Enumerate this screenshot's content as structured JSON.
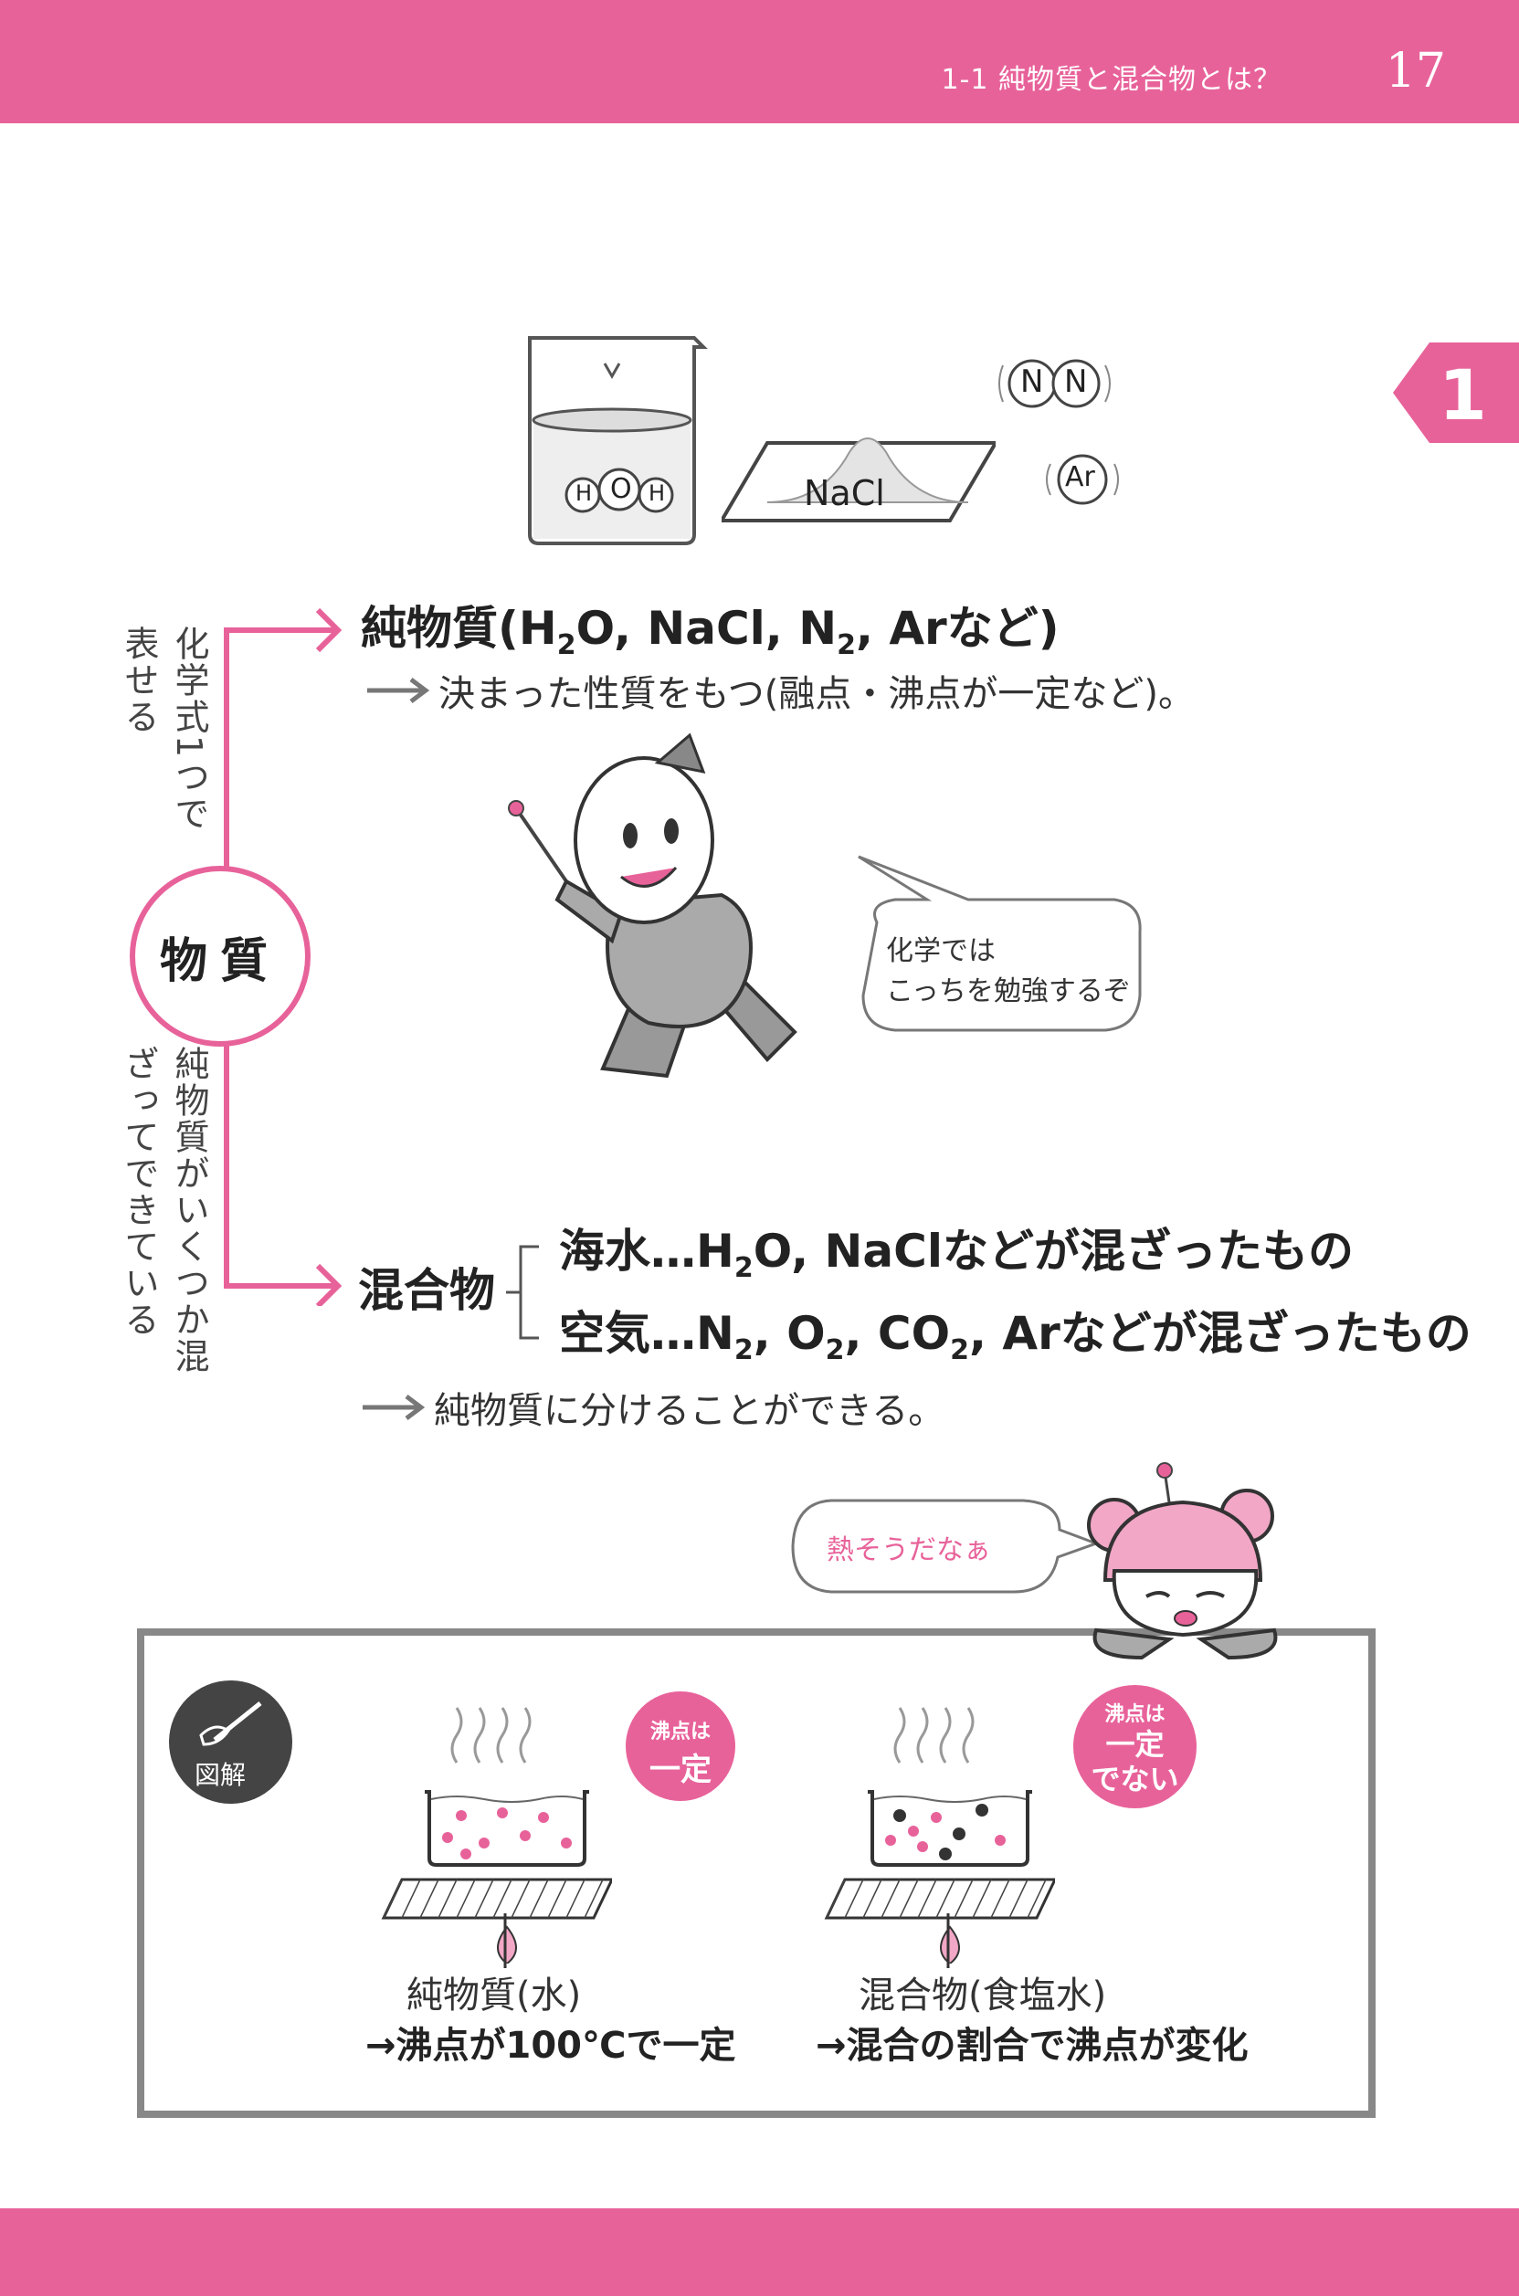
{
  "header": {
    "section_title": "1-1  純物質と混合物とは？",
    "page_number": "17",
    "chapter_tab": "1"
  },
  "illustrations": {
    "water_atoms": [
      "H",
      "O",
      "H"
    ],
    "salt_label": "NaCl",
    "gas_atoms": [
      "N",
      "N",
      "Ar"
    ]
  },
  "substance_circle": "物質",
  "left_labels": {
    "top": "化学式1つで表せる",
    "bottom": "純物質がいくつか混ざってできている"
  },
  "pure": {
    "heading_prefix": "純物質(H",
    "heading_sub": "2",
    "heading_rest": "O, NaCl, N",
    "heading_sub2": "2",
    "heading_end": ", Arなど)",
    "note": "決まった性質をもつ(融点・沸点が一定など)。"
  },
  "professor_bubble": {
    "line1": "化学では",
    "line2": "こっちを勉強するぞ"
  },
  "mixture": {
    "label": "混合物",
    "sea_prefix": "海水…H",
    "sea_sub": "2",
    "sea_rest": "O, NaClなどが混ざったもの",
    "air_prefix": "空気…N",
    "air_sub1": "2",
    "air_mid1": ", O",
    "air_sub2": "2",
    "air_mid2": ", CO",
    "air_sub3": "2",
    "air_rest": ", Arなどが混ざったもの",
    "note": "純物質に分けることができる。"
  },
  "girl_bubble": "熱そうだなぁ",
  "diagram": {
    "icon_label": "図解",
    "left_badge_line1": "沸点は",
    "left_badge_line2": "一定",
    "right_badge_line1": "沸点は",
    "right_badge_line2": "一定",
    "right_badge_line3": "でない",
    "left_caption": "純物質(水)",
    "left_result": "→沸点が100℃で一定",
    "right_caption": "混合物(食塩水)",
    "right_result": "→混合の割合で沸点が変化"
  },
  "colors": {
    "accent": "#e8629a",
    "frame": "#888888",
    "dot_dark": "#333333"
  }
}
